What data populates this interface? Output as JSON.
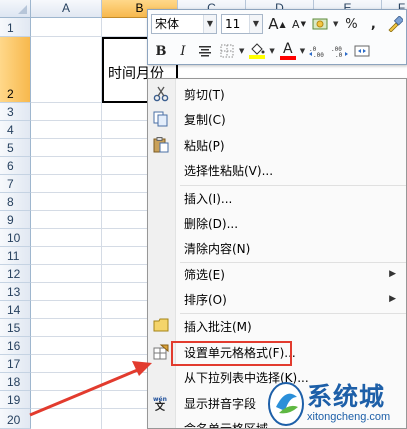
{
  "sheet": {
    "columns": [
      "A",
      "B",
      "C",
      "D",
      "E",
      "F"
    ],
    "rows": [
      "1",
      "2",
      "3",
      "4",
      "5",
      "6",
      "7",
      "8",
      "9",
      "10",
      "11",
      "12",
      "13",
      "14",
      "15",
      "16",
      "17",
      "18",
      "19",
      "20"
    ],
    "selected_column": "B",
    "selected_row": "2",
    "active_cell_text": "时间月份"
  },
  "mini_toolbar": {
    "font_name": "宋体",
    "font_size": "11",
    "grow_font": "A",
    "shrink_font": "A",
    "percent": "%",
    "comma": ",",
    "bold": "B",
    "italic": "I",
    "font_color_letter": "A",
    "colors": {
      "fill": "#ffff00",
      "font": "#ff0000"
    }
  },
  "context_menu": {
    "items": [
      {
        "label": "剪切(T)",
        "icon": "scissors-icon"
      },
      {
        "label": "复制(C)",
        "icon": "copy-icon"
      },
      {
        "label": "粘贴(P)",
        "icon": "paste-icon"
      },
      {
        "label": "选择性粘贴(V)...",
        "icon": ""
      },
      {
        "label": "插入(I)...",
        "icon": ""
      },
      {
        "label": "删除(D)...",
        "icon": ""
      },
      {
        "label": "清除内容(N)",
        "icon": ""
      },
      {
        "label": "筛选(E)",
        "icon": "",
        "submenu": true
      },
      {
        "label": "排序(O)",
        "icon": "",
        "submenu": true
      },
      {
        "label": "插入批注(M)",
        "icon": "comment-icon"
      },
      {
        "label": "设置单元格格式(F)...",
        "icon": "format-cells-icon",
        "highlighted": true
      },
      {
        "label": "从下拉列表中选择(K)...",
        "icon": ""
      },
      {
        "label": "显示拼音字段",
        "icon": "phonetic-icon"
      },
      {
        "label": "命名单元格区域",
        "icon": ""
      }
    ]
  },
  "watermark": {
    "brand": "系统城",
    "url": "xitongcheng.com",
    "color": "#1d5fa8"
  },
  "annotation": {
    "color": "#e23b2e"
  }
}
